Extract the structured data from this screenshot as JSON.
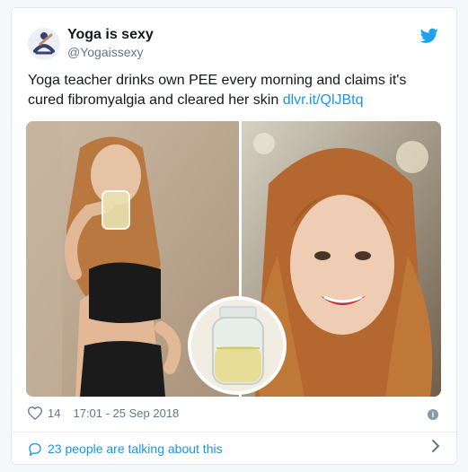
{
  "author": {
    "name": "Yoga is sexy",
    "handle": "@Yogaissexy"
  },
  "tweet": {
    "text": "Yoga teacher drinks own PEE every morning and claims it's cured fibromyalgia and cleared her skin ",
    "link": "dlvr.it/QlJBtq"
  },
  "meta": {
    "likes": "14",
    "timestamp": "17:01 - 25 Sep 2018"
  },
  "footer": {
    "talking": "23 people are talking about this"
  },
  "icons": {
    "brand": "twitter-bird-icon",
    "like": "heart-icon",
    "info": "info-icon",
    "comment": "speech-bubble-icon",
    "chevron": "chevron-right-icon"
  },
  "colors": {
    "link": "#1b95e0",
    "text": "#14171a",
    "muted": "#657786",
    "twitter_blue": "#1da1f2"
  }
}
